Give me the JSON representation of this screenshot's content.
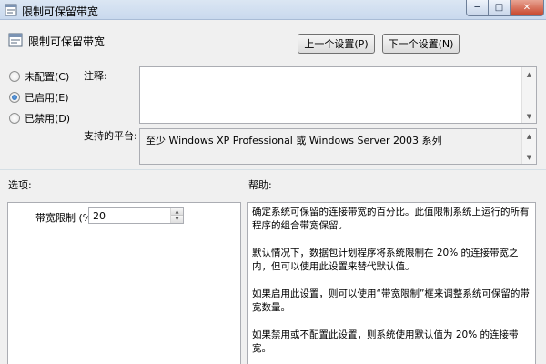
{
  "window": {
    "title": "限制可保留带宽",
    "minimize_glyph": "─",
    "maximize_glyph": "□",
    "close_glyph": "✕"
  },
  "header": {
    "policy_name": "限制可保留带宽",
    "prev_button": "上一个设置(P)",
    "next_button": "下一个设置(N)"
  },
  "state": {
    "options": [
      {
        "label": "未配置(C)",
        "checked": false
      },
      {
        "label": "已启用(E)",
        "checked": true
      },
      {
        "label": "已禁用(D)",
        "checked": false
      }
    ]
  },
  "comment": {
    "label": "注释:",
    "value": ""
  },
  "platform": {
    "label": "支持的平台:",
    "value": "至少 Windows XP Professional 或 Windows Server 2003 系列"
  },
  "options_section": {
    "label": "选项:",
    "bandwidth_label": "带宽限制 (%):",
    "bandwidth_value": "20"
  },
  "help_section": {
    "label": "帮助:",
    "paragraphs": [
      "确定系统可保留的连接带宽的百分比。此值限制系统上运行的所有程序的组合带宽保留。",
      "默认情况下，数据包计划程序将系统限制在 20% 的连接带宽之内，但可以使用此设置来替代默认值。",
      "如果启用此设置，则可以使用“带宽限制”框来调整系统可保留的带宽数量。",
      "如果禁用或不配置此设置，则系统使用默认值为 20% 的连接带宽。"
    ]
  },
  "icons": {
    "app": "policy-setting-icon",
    "header": "policy-setting-icon"
  }
}
